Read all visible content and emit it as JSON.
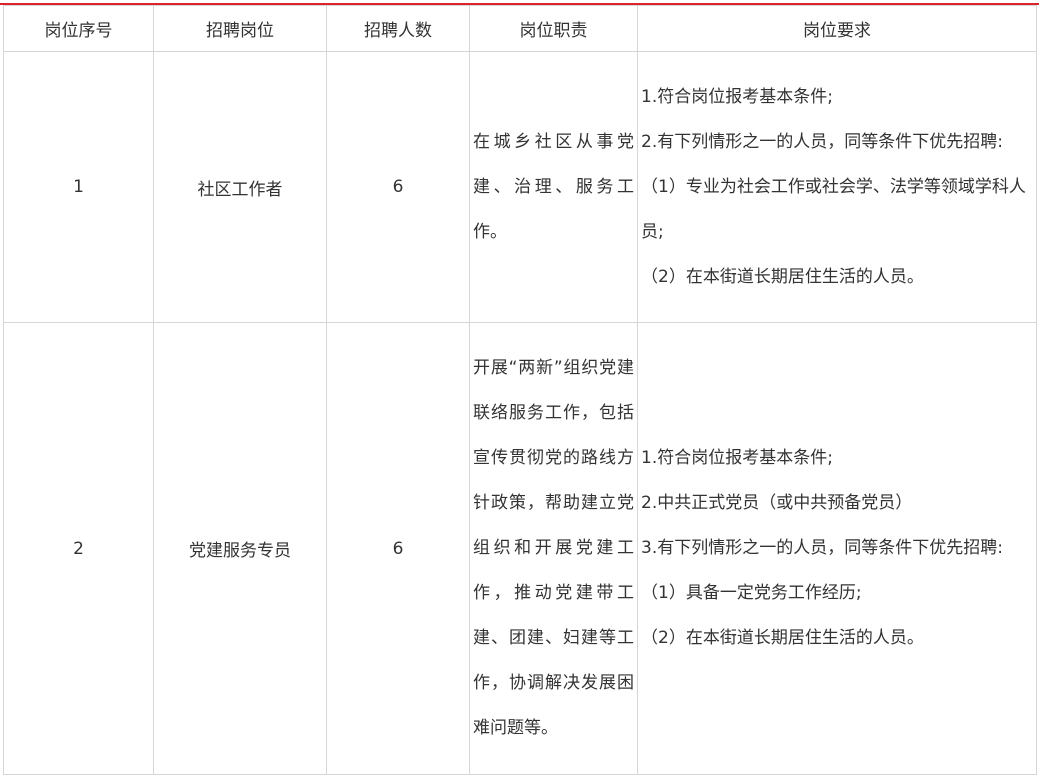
{
  "headers": [
    "岗位序号",
    "招聘岗位",
    "招聘人数",
    "岗位职责",
    "岗位要求"
  ],
  "rows": [
    {
      "seq": "1",
      "position": "社区工作者",
      "count": "6",
      "duty": "在城乡社区从事党建、治理、服务工作。",
      "requirements": [
        "1.符合岗位报考基本条件;",
        "2.有下列情形之一的人员，同等条件下优先招聘:",
        "（1）专业为社会工作或社会学、法学等领域学科人员;",
        "（2）在本街道长期居住生活的人员。"
      ]
    },
    {
      "seq": "2",
      "position": "党建服务专员",
      "count": "6",
      "duty": "开展“两新”组织党建联络服务工作，包括宣传贯彻党的路线方针政策，帮助建立党组织和开展党建工作，推动党建带工建、团建、妇建等工作，协调解决发展困难问题等。",
      "requirements": [
        "1.符合岗位报考基本条件;",
        "2.中共正式党员（或中共预备党员）",
        "3.有下列情形之一的人员，同等条件下优先招聘:",
        "（1）具备一定党务工作经历;",
        "（2）在本街道长期居住生活的人员。"
      ]
    }
  ]
}
